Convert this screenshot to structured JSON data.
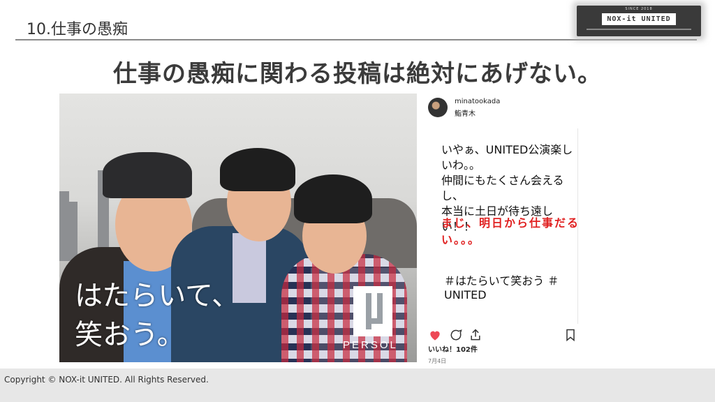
{
  "slide": {
    "title": "10.仕事の愚痴",
    "headline": "仕事の愚痴に関わる投稿は絶対にあげない。"
  },
  "logo": {
    "since": "SINCE 2018",
    "name": "NOX-it UNITED"
  },
  "photo": {
    "caption_line1": "はたらいて、",
    "caption_line2": "笑おう。",
    "brand": "PERSOL"
  },
  "post": {
    "username": "minatookada",
    "location": "鮨青木",
    "body_line1": "いやぁ、UNITED公演楽しいわ。。",
    "body_line2": "仲間にもたくさん会えるし、",
    "body_line3": "本当に土日が待ち遠しい！！",
    "highlight": "まじ、明日から仕事だるい。。。",
    "hashtags": "＃はたらいて笑おう ＃UNITED",
    "likes": "いいね！102件",
    "date": "7月4日",
    "heart_color": "#ed4956"
  },
  "footer": {
    "copyright": "Copyright © NOX-it UNITED. All Rights Reserved."
  }
}
